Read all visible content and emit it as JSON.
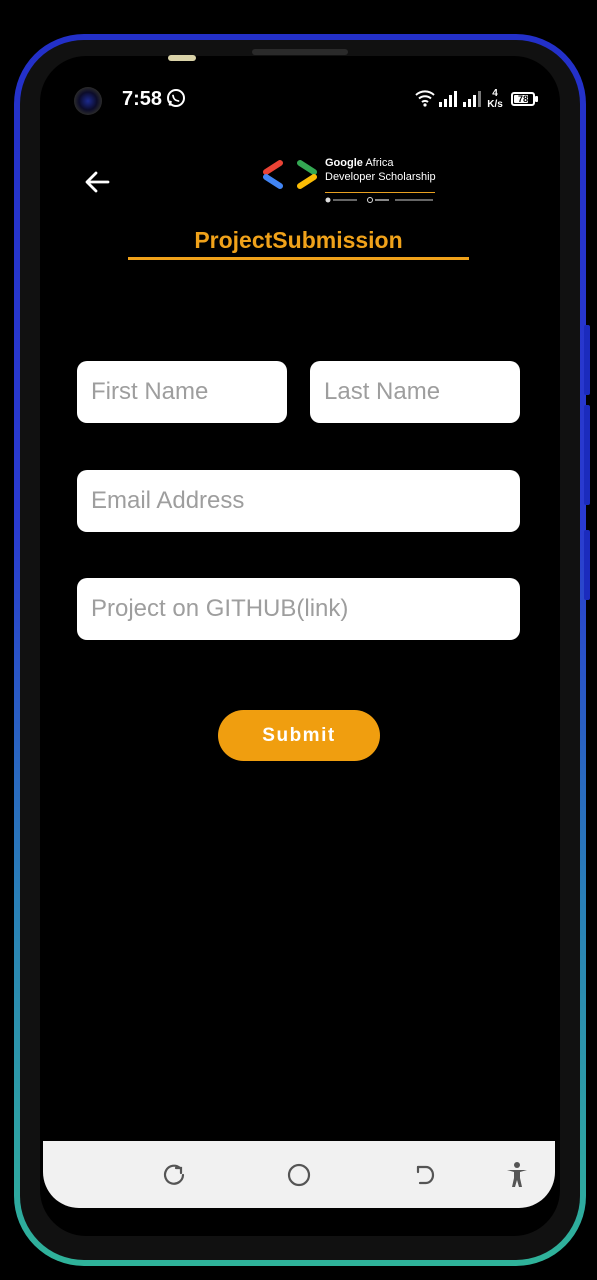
{
  "status_bar": {
    "time": "7:58",
    "net_speed_value": "4",
    "net_speed_unit": "K/s",
    "battery": "78",
    "battery_level_percent": 78,
    "icons": [
      "whatsapp-icon",
      "wifi-icon",
      "signal-icon",
      "signal-icon",
      "battery-icon"
    ]
  },
  "header": {
    "back_icon": "arrow-left-icon",
    "logo_line1_bold": "Google",
    "logo_line1_rest": " Africa",
    "logo_line2": "Developer Scholarship",
    "title": "ProjectSubmission"
  },
  "form": {
    "first_name": {
      "placeholder": "First Name",
      "value": ""
    },
    "last_name": {
      "placeholder": "Last Name",
      "value": ""
    },
    "email": {
      "placeholder": "Email Address",
      "value": ""
    },
    "github": {
      "placeholder": "Project on GITHUB(link)",
      "value": ""
    },
    "submit_label": "Submit"
  },
  "nav_bar": {
    "icons": [
      "recent-apps-icon",
      "home-icon",
      "back-icon",
      "accessibility-icon"
    ]
  },
  "colors": {
    "accent": "#f0a21a",
    "background": "#000000",
    "field_background": "#ffffff",
    "placeholder": "#9e9e9e"
  }
}
